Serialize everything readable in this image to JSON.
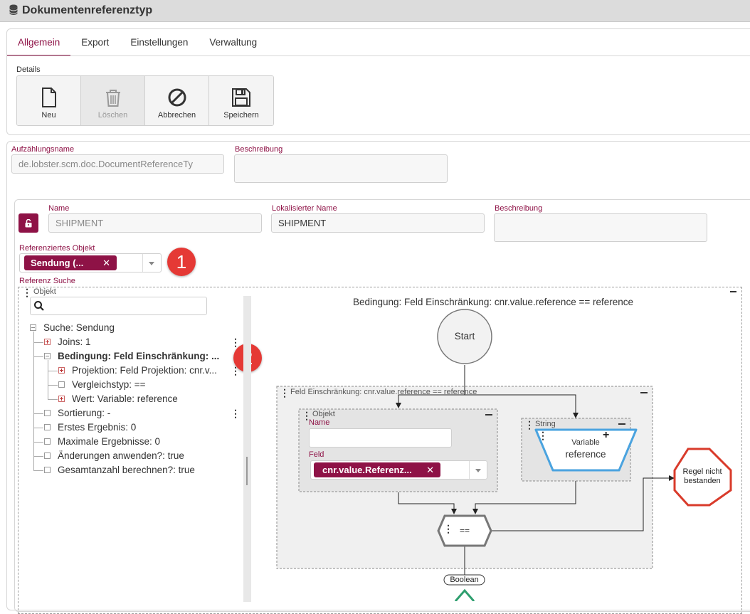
{
  "window": {
    "title": "Dokumentenreferenztyp",
    "icon": "database-icon"
  },
  "tabs": [
    {
      "label": "Allgemein",
      "active": true
    },
    {
      "label": "Export",
      "active": false
    },
    {
      "label": "Einstellungen",
      "active": false
    },
    {
      "label": "Verwaltung",
      "active": false
    }
  ],
  "details": {
    "label": "Details",
    "buttons": [
      {
        "label": "Neu",
        "icon": "new-document-icon",
        "disabled": false
      },
      {
        "label": "Löschen",
        "icon": "trash-icon",
        "disabled": true
      },
      {
        "label": "Abbrechen",
        "icon": "cancel-icon",
        "disabled": false
      },
      {
        "label": "Speichern",
        "icon": "save-icon",
        "disabled": false
      }
    ]
  },
  "enum_form": {
    "name_label": "Aufzählungsname",
    "name_value": "de.lobster.scm.doc.DocumentReferenceTy",
    "description_label": "Beschreibung",
    "description_value": ""
  },
  "entry_form": {
    "name_label": "Name",
    "name_value": "SHIPMENT",
    "localized_label": "Lokalisierter Name",
    "localized_value": "SHIPMENT",
    "description_label": "Beschreibung",
    "description_value": "",
    "referenced_object_label": "Referenziertes Objekt",
    "referenced_object_chip": "Sendung (...",
    "reference_search_label": "Referenz Suche"
  },
  "badges": {
    "one": "1",
    "two": "2"
  },
  "tree": {
    "header": "Objekt",
    "search_placeholder": "",
    "items": [
      {
        "label": "Suche: Sendung"
      },
      {
        "label": "Joins: 1"
      },
      {
        "label": "Bedingung: Feld Einschränkung: ..."
      },
      {
        "label": "Projektion: Feld Projektion: cnr.v..."
      },
      {
        "label": "Vergleichstyp: =="
      },
      {
        "label": "Wert: Variable: reference"
      },
      {
        "label": "Sortierung: -"
      },
      {
        "label": "Erstes Ergebnis: 0"
      },
      {
        "label": "Maximale Ergebnisse: 0"
      },
      {
        "label": "Änderungen anwenden?: true"
      },
      {
        "label": "Gesamtanzahl berechnen?: true"
      }
    ]
  },
  "diagram": {
    "title": "Bedingung: Feld Einschränkung: cnr.value.reference == reference",
    "start": "Start",
    "group_title": "Feld Einschränkung: cnr.value.reference == reference",
    "object_box": {
      "title": "Objekt",
      "name_label": "Name",
      "name_value": "",
      "field_label": "Feld",
      "field_chip": "cnr.value.Referenz..."
    },
    "string_box": {
      "title": "String",
      "line1": "Variable",
      "line2": "reference"
    },
    "operator": "==",
    "fail_node": {
      "line1": "Regel nicht",
      "line2": "bestanden"
    },
    "boolean_label": "Boolean"
  },
  "colors": {
    "accent": "#8e1246",
    "badge_red": "#e53935",
    "stop_red": "#d93b2b",
    "variable_blue": "#4aa3df",
    "success_green": "#2e9e6e"
  }
}
